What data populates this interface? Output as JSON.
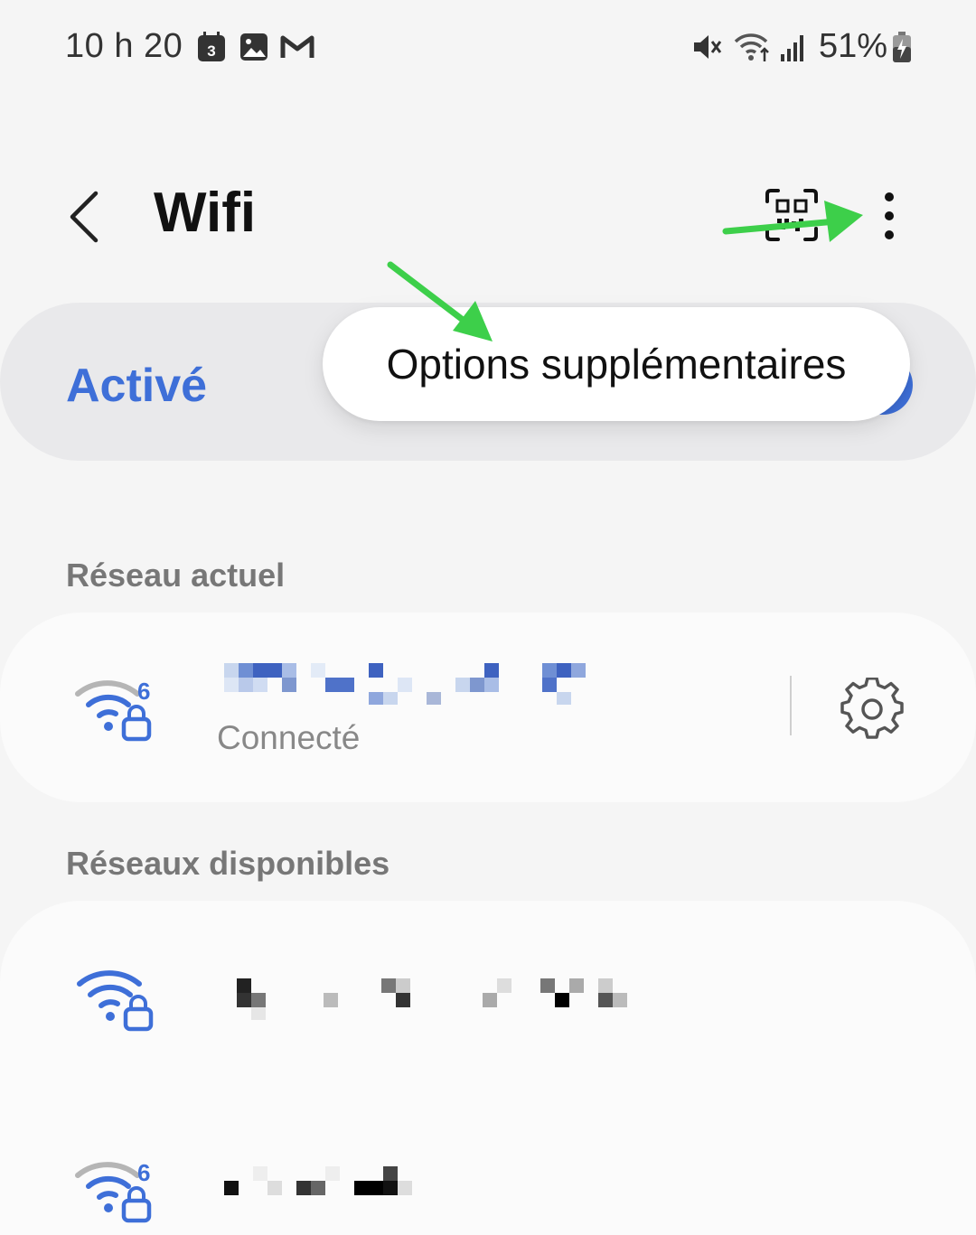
{
  "status_bar": {
    "time": "10 h 20",
    "calendar_badge": "3",
    "battery": "51%",
    "icons": [
      "calendar-icon",
      "gallery-icon",
      "gmail-icon",
      "mute-icon",
      "wifi-status-icon",
      "signal-icon",
      "battery-charging-icon"
    ]
  },
  "header": {
    "title": "Wifi",
    "back_icon": "chevron-left-icon",
    "qr_icon": "qr-scan-icon",
    "more_icon": "more-vert-icon"
  },
  "toggle": {
    "label": "Activé",
    "state": "on",
    "accent": "#3e6fd8"
  },
  "tooltip": {
    "text": "Options supplémentaires"
  },
  "current_section": {
    "label": "Réseau actuel",
    "network": {
      "status": "Connecté",
      "name_pixelated": true,
      "wifi_standard": "6",
      "secured": true
    }
  },
  "available_section": {
    "label": "Réseaux disponibles",
    "networks": [
      {
        "wifi_standard": "",
        "secured": true,
        "name_pixelated": true
      },
      {
        "wifi_standard": "6",
        "secured": true,
        "name_pixelated": true
      }
    ]
  },
  "annotation": {
    "arrow_color": "#3dcf4a"
  }
}
